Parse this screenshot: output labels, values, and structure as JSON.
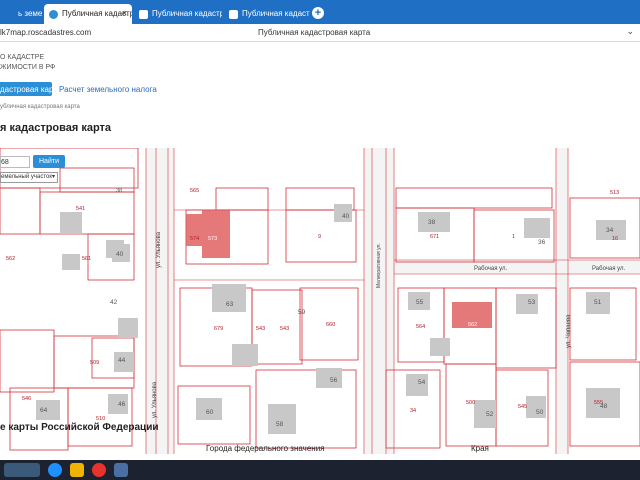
{
  "browser": {
    "tabs": [
      {
        "label": "ь земельный у",
        "active": false
      },
      {
        "label": "Публичная кадастровая",
        "active": true,
        "close": "×"
      },
      {
        "label": "Публичная кадастровая",
        "active": false
      },
      {
        "label": "Публичная кадастровая",
        "active": false
      }
    ],
    "new_tab": "+",
    "url": "lk7map.roscadastres.com",
    "page_title": "Публичная кадастровая карта",
    "menu_icon": "⌄"
  },
  "header": {
    "logo_line1": "о кадастре",
    "logo_line2": "жимости в РФ"
  },
  "nav": {
    "active_tab": "дастровая карта",
    "tab2": "Расчет земельного налога"
  },
  "breadcrumb": "убличная кадастровая карта",
  "heading": "я кадастровая карта",
  "map": {
    "search_value": "68",
    "search_button": "Найти",
    "object_type": "емельный участок",
    "colors": {
      "boundary": "#d0303a",
      "building": "#c8c8c8",
      "highlight": "#e06060",
      "road": "#e4e4e4"
    },
    "streets": [
      {
        "label": "ул. Ульянова"
      },
      {
        "label": "Мелиоративная ул."
      },
      {
        "label": "Рабочая ул."
      },
      {
        "label": "Рабочая ул."
      },
      {
        "label": "ул. Чапаева"
      },
      {
        "label": "ул. Ульянова"
      }
    ],
    "lots": [
      {
        "label": "562"
      },
      {
        "label": "561"
      },
      {
        "label": "541"
      },
      {
        "label": "565"
      },
      {
        "label": "38"
      },
      {
        "label": "40"
      },
      {
        "label": "42"
      },
      {
        "label": "44"
      },
      {
        "label": "46"
      },
      {
        "label": "64"
      },
      {
        "label": "510"
      },
      {
        "label": "509"
      },
      {
        "label": "546"
      },
      {
        "label": "574"
      },
      {
        "label": "573"
      },
      {
        "label": "9"
      },
      {
        "label": "40"
      },
      {
        "label": "63"
      },
      {
        "label": "679"
      },
      {
        "label": "543"
      },
      {
        "label": "59"
      },
      {
        "label": "660"
      },
      {
        "label": "56"
      },
      {
        "label": "60"
      },
      {
        "label": "58"
      },
      {
        "label": "38"
      },
      {
        "label": "671"
      },
      {
        "label": "36"
      },
      {
        "label": "34"
      },
      {
        "label": "55"
      },
      {
        "label": "564"
      },
      {
        "label": "562"
      },
      {
        "label": "53"
      },
      {
        "label": "51"
      },
      {
        "label": "54"
      },
      {
        "label": "500"
      },
      {
        "label": "52"
      },
      {
        "label": "50"
      },
      {
        "label": "48"
      },
      {
        "label": "34"
      },
      {
        "label": "545"
      },
      {
        "label": "555"
      },
      {
        "label": "543"
      },
      {
        "label": "513"
      },
      {
        "label": "1"
      },
      {
        "label": "16"
      }
    ]
  },
  "lists": {
    "heading": "е карты Российской Федерации",
    "col1": "Города федерального значения",
    "col2": "Края"
  }
}
